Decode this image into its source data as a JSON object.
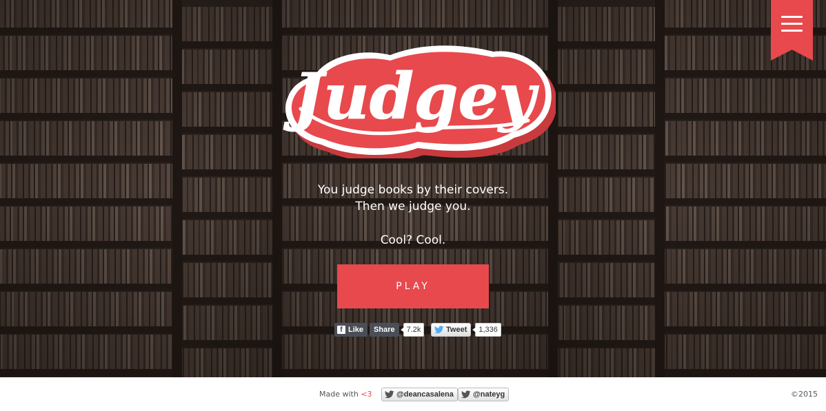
{
  "hero": {
    "logo_text": "Judgey",
    "tagline_line1": "You judge books by their covers.",
    "tagline_line2": "Then we judge you.",
    "tagline_line3": "Cool? Cool.",
    "play_label": "PLAY"
  },
  "social": {
    "fb_like_label": "Like",
    "fb_share_label": "Share",
    "fb_count": "7.2k",
    "tweet_label": "Tweet",
    "tweet_count": "1,336"
  },
  "footer": {
    "made_with": "Made with ",
    "heart": "<3",
    "handle_1": "@deancasalena",
    "handle_2": "@nateyg",
    "copyright": "©2015"
  },
  "colors": {
    "accent": "#e8494d",
    "footer_bg": "#ffffff",
    "text_light": "#ffffff"
  },
  "icons": {
    "menu": "hamburger-icon",
    "facebook": "facebook-icon",
    "twitter": "twitter-bird-icon"
  }
}
